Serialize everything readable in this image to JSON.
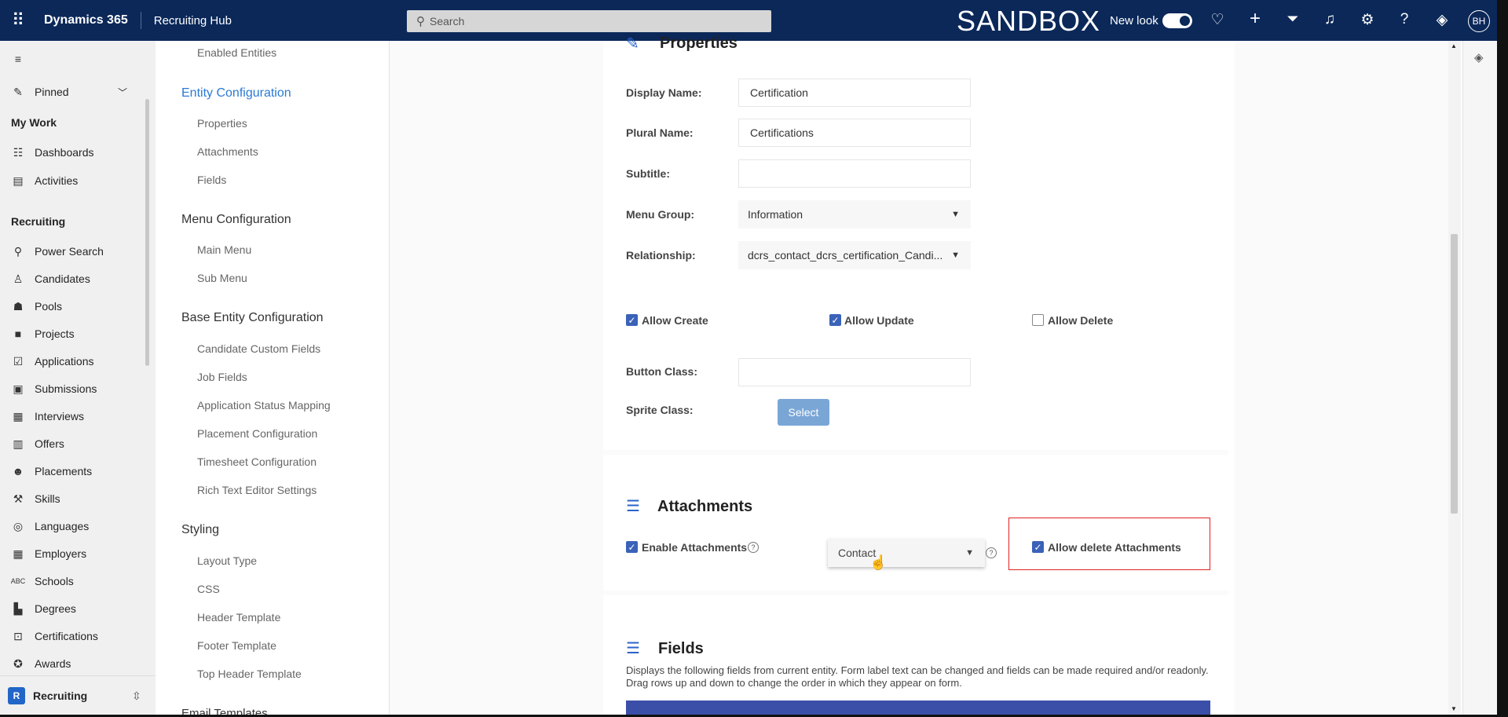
{
  "topbar": {
    "brand": "Dynamics 365",
    "app_name": "Recruiting Hub",
    "search_placeholder": "Search",
    "environment": "SANDBOX",
    "new_look_label": "New look",
    "new_look_on": true,
    "avatar_initials": "BH"
  },
  "nav": {
    "pinned": "Pinned",
    "my_work": "My Work",
    "my_work_items": [
      "Dashboards",
      "Activities"
    ],
    "recruiting": "Recruiting",
    "recruiting_items": [
      "Power Search",
      "Candidates",
      "Pools",
      "Projects",
      "Applications",
      "Submissions",
      "Interviews",
      "Offers",
      "Placements",
      "Skills",
      "Languages",
      "Employers",
      "Schools",
      "Degrees",
      "Certifications",
      "Awards"
    ],
    "area_badge": "R",
    "area_name": "Recruiting"
  },
  "config": {
    "enabled_entities": "Enabled Entities",
    "entity_configuration": "Entity Configuration",
    "entity_items": [
      "Properties",
      "Attachments",
      "Fields"
    ],
    "menu_configuration": "Menu Configuration",
    "menu_items": [
      "Main Menu",
      "Sub Menu"
    ],
    "base_entity_configuration": "Base Entity Configuration",
    "base_items": [
      "Candidate Custom Fields",
      "Job Fields",
      "Application Status Mapping",
      "Placement Configuration",
      "Timesheet Configuration",
      "Rich Text Editor Settings"
    ],
    "styling": "Styling",
    "styling_items": [
      "Layout Type",
      "CSS",
      "Header Template",
      "Footer Template",
      "Top Header Template"
    ],
    "email_templates": "Email Templates"
  },
  "properties": {
    "title": "Properties",
    "display_name_label": "Display Name:",
    "display_name_value": "Certification",
    "plural_name_label": "Plural Name:",
    "plural_name_value": "Certifications",
    "subtitle_label": "Subtitle:",
    "subtitle_value": "",
    "menu_group_label": "Menu Group:",
    "menu_group_value": "Information",
    "relationship_label": "Relationship:",
    "relationship_value": "dcrs_contact_dcrs_certification_Candi...",
    "allow_create_label": "Allow Create",
    "allow_create": true,
    "allow_update_label": "Allow Update",
    "allow_update": true,
    "allow_delete_label": "Allow Delete",
    "allow_delete": false,
    "button_class_label": "Button Class:",
    "button_class_value": "",
    "sprite_class_label": "Sprite Class:",
    "select_button": "Select"
  },
  "attachments": {
    "title": "Attachments",
    "enable_label": "Enable Attachments",
    "enable": true,
    "entity_value": "Contact",
    "allow_delete_label": "Allow delete Attachments",
    "allow_delete": true
  },
  "fields": {
    "title": "Fields",
    "description": "Displays the following fields from current entity. Form label text can be changed and fields can be made required and/or readonly. Drag rows up and down to change the order in which they appear on form."
  },
  "colors": {
    "topbar": "#0b2859",
    "accent": "#2a7ad5",
    "checkbox": "#3a62b8",
    "highlight": "#e02020",
    "table_header": "#3b4ea8"
  }
}
